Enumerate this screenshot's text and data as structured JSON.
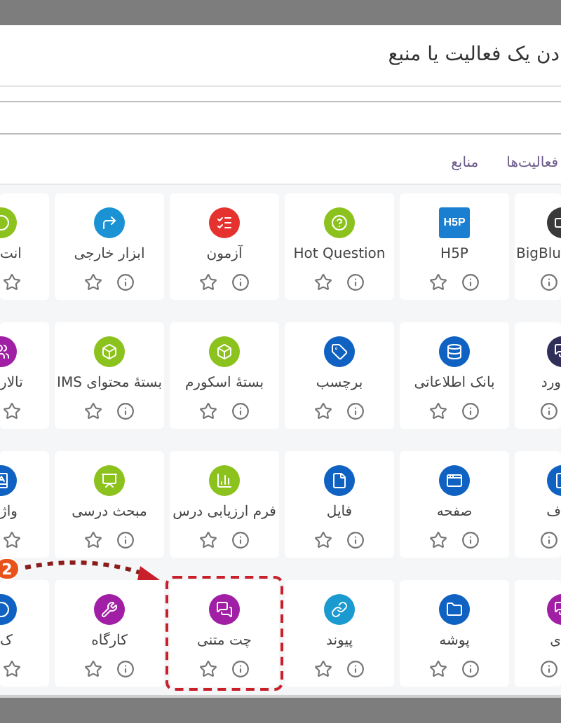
{
  "dialog": {
    "title": "دن یک فعالیت یا منبع"
  },
  "tabs": [
    {
      "label": "فعالیت‌ها",
      "selected": false
    },
    {
      "label": "منابع",
      "selected": false
    }
  ],
  "rows": [
    [
      {
        "label": "BigBlu",
        "kind": "video",
        "color": "#3a3a3a"
      },
      {
        "label": "H5P",
        "kind": "logo",
        "logo_text": "H5P",
        "color": "#1a7fd1",
        "starred": false
      },
      {
        "label": "Hot Question",
        "kind": "question",
        "color": "#8cc21e",
        "starred": false
      },
      {
        "label": "آزمون",
        "kind": "quiz",
        "color": "#e5322f",
        "starred": false
      },
      {
        "label": "ابزار خارجی",
        "kind": "tool",
        "color": "#1b92d3",
        "starred": false
      },
      {
        "label": "انت",
        "kind": "circle",
        "color": "#8cc21e",
        "starred": false
      }
    ],
    [
      {
        "label": "ورد",
        "kind": "chat",
        "color": "#2f2f5a"
      },
      {
        "label": "بانک اطلاعاتی",
        "kind": "database",
        "color": "#0f62c2",
        "starred": false
      },
      {
        "label": "برچسب",
        "kind": "tag",
        "color": "#0f62c2",
        "starred": false
      },
      {
        "label": "بستهٔ اسکورم",
        "kind": "box",
        "color": "#8cc21e",
        "starred": false
      },
      {
        "label": "بستهٔ محتوای IMS",
        "kind": "box",
        "color": "#8cc21e",
        "starred": false
      },
      {
        "label": "تالار",
        "kind": "users",
        "color": "#a01fa5",
        "starred": false
      }
    ],
    [
      {
        "label": "ف",
        "kind": "file",
        "color": "#0f62c2"
      },
      {
        "label": "صفحه",
        "kind": "window",
        "color": "#0f62c2",
        "starred": false
      },
      {
        "label": "فایل",
        "kind": "file",
        "color": "#0f62c2",
        "starred": false
      },
      {
        "label": "فرم ارزیابی درس",
        "kind": "chart",
        "color": "#8cc21e",
        "starred": false
      },
      {
        "label": "مبحث درسی",
        "kind": "board",
        "color": "#8cc21e",
        "starred": false
      },
      {
        "label": "واژ",
        "kind": "book",
        "color": "#0f62c2",
        "starred": false
      }
    ],
    [
      {
        "label": "ی",
        "kind": "chat",
        "color": "#a01fa5"
      },
      {
        "label": "پوشه",
        "kind": "folder",
        "color": "#0f62c2",
        "starred": false
      },
      {
        "label": "پیوند",
        "kind": "link",
        "color": "#1b9ad0",
        "starred": false
      },
      {
        "label": "چت متنی",
        "kind": "chat",
        "color": "#a01fa5",
        "starred": false,
        "highlighted": true
      },
      {
        "label": "کارگاه",
        "kind": "wrench",
        "color": "#a01fa5",
        "starred": false
      },
      {
        "label": "ک",
        "kind": "circle",
        "color": "#0f62c2",
        "starred": false
      }
    ]
  ],
  "annotation": {
    "badge": "2"
  }
}
